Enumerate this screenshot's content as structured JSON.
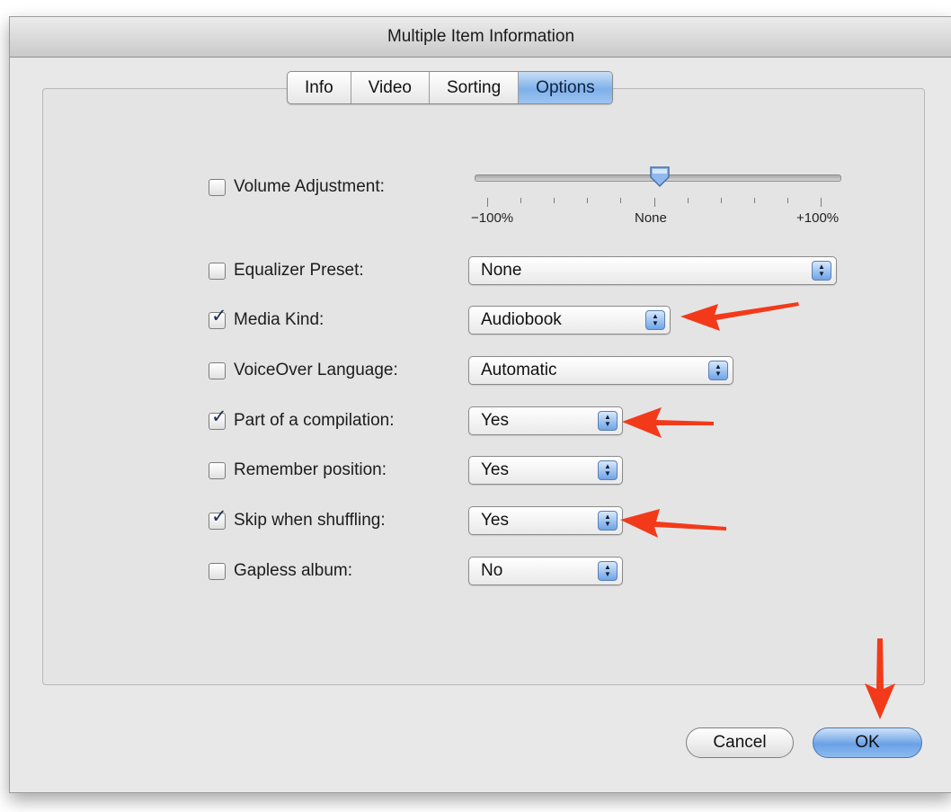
{
  "window": {
    "title": "Multiple Item Information"
  },
  "tabs": [
    {
      "label": "Info",
      "active": false
    },
    {
      "label": "Video",
      "active": false
    },
    {
      "label": "Sorting",
      "active": false
    },
    {
      "label": "Options",
      "active": true
    }
  ],
  "options": {
    "volume": {
      "label": "Volume Adjustment:",
      "checked": false,
      "level_percent": 0,
      "min_label": "−100%",
      "mid_label": "None",
      "max_label": "+100%"
    },
    "equalizer": {
      "label": "Equalizer Preset:",
      "checked": false,
      "value": "None"
    },
    "media_kind": {
      "label": "Media Kind:",
      "checked": true,
      "value": "Audiobook"
    },
    "voiceover": {
      "label": "VoiceOver Language:",
      "checked": false,
      "value": "Automatic"
    },
    "compilation": {
      "label": "Part of a compilation:",
      "checked": true,
      "value": "Yes"
    },
    "remember": {
      "label": "Remember position:",
      "checked": false,
      "value": "Yes"
    },
    "skip_shuffle": {
      "label": "Skip when shuffling:",
      "checked": true,
      "value": "Yes"
    },
    "gapless": {
      "label": "Gapless album:",
      "checked": false,
      "value": "No"
    }
  },
  "buttons": {
    "cancel": "Cancel",
    "ok": "OK"
  },
  "colors": {
    "annotation_arrow": "#f23a1a",
    "selection_blue": "#6aa1e6"
  },
  "icons": {
    "checkmark": "✓"
  }
}
